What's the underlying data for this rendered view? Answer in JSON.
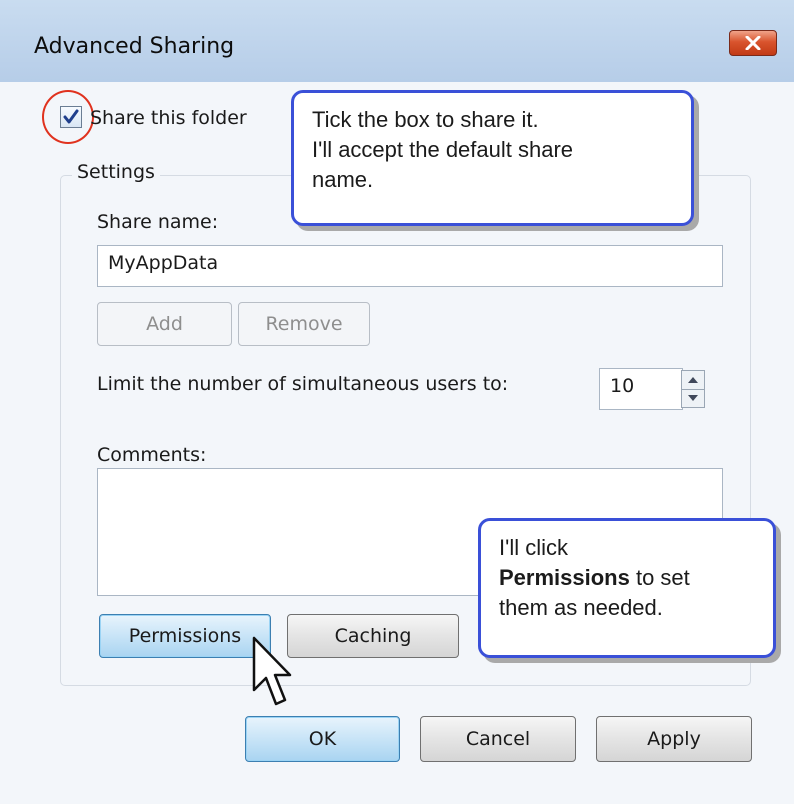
{
  "window": {
    "title": "Advanced Sharing",
    "close_icon": "close-x-icon"
  },
  "share": {
    "checkbox_checked": true,
    "label": "Share this folder"
  },
  "settings": {
    "group_label": "Settings",
    "share_name_label": "Share name:",
    "share_name_value": "MyAppData",
    "add_label": "Add",
    "remove_label": "Remove",
    "limit_label": "Limit the number of simultaneous users to:",
    "limit_value": "10",
    "comments_label": "Comments:",
    "comments_value": "",
    "permissions_label": "Permissions",
    "caching_label": "Caching"
  },
  "footer": {
    "ok_label": "OK",
    "cancel_label": "Cancel",
    "apply_label": "Apply"
  },
  "callouts": {
    "top": {
      "line1": "Tick the box to share it.",
      "line2": "I'll accept the default share",
      "line3": "name."
    },
    "bottom": {
      "line1": "I'll click",
      "bold": "Permissions",
      "line2_rest": " to set",
      "line3": "them as needed."
    }
  },
  "colors": {
    "callout_border": "#3a50d8",
    "highlight_circle": "#e0321e",
    "titlebar": "#c9dcf0"
  }
}
